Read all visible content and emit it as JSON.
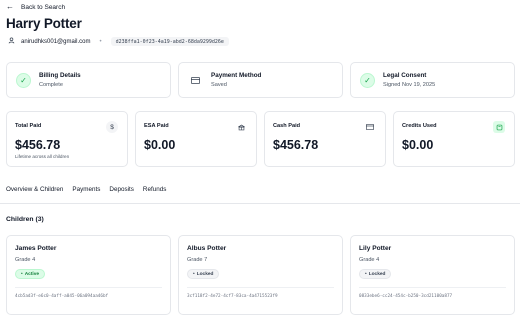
{
  "nav": {
    "back_label": "Back to Search",
    "back_icon": "arrow-left-icon"
  },
  "header": {
    "title": "Harry Potter",
    "email": "anirudhks001@gmail.com",
    "separator": "•",
    "user_id": "d238ffa1-0f23-4a19-abd2-68da9299d26e"
  },
  "status_cards": [
    {
      "title": "Billing Details",
      "subtitle": "Complete",
      "icon": "check-circle-icon"
    },
    {
      "title": "Payment Method",
      "subtitle": "Saved",
      "icon": "credit-card-icon"
    },
    {
      "title": "Legal Consent",
      "subtitle": "Signed Nov 19, 2025",
      "icon": "check-circle-icon"
    }
  ],
  "stats": [
    {
      "label": "Total Paid",
      "value": "$456.78",
      "sub": "Lifetime across all children",
      "icon": "dollar-icon"
    },
    {
      "label": "ESA Paid",
      "value": "$0.00",
      "sub": "",
      "icon": "bank-icon"
    },
    {
      "label": "Cash Paid",
      "value": "$456.78",
      "sub": "",
      "icon": "credit-card-icon"
    },
    {
      "label": "Credits Used",
      "value": "$0.00",
      "sub": "",
      "icon": "credit-icon"
    }
  ],
  "tabs": [
    "Overview & Children",
    "Payments",
    "Deposits",
    "Refunds"
  ],
  "children_section": {
    "title": "Children (3)"
  },
  "children": [
    {
      "name": "James Potter",
      "grade": "Grade 4",
      "status": "Active",
      "id": "4cb5ad3f-e6c0-4aff-a045-06a094aa46bf"
    },
    {
      "name": "Albus Potter",
      "grade": "Grade 7",
      "status": "Locked",
      "id": "3cf118f2-4e72-4cf7-83ca-4a4715523f9"
    },
    {
      "name": "Lily Potter",
      "grade": "Grade 4",
      "status": "Locked",
      "id": "0833ebe6-cc24-454c-b250-3cd21100a877"
    }
  ],
  "colors": {
    "success": "#16a34a",
    "success_bg": "#dcfce7",
    "border": "#e5e7eb",
    "muted": "#4b5563"
  }
}
